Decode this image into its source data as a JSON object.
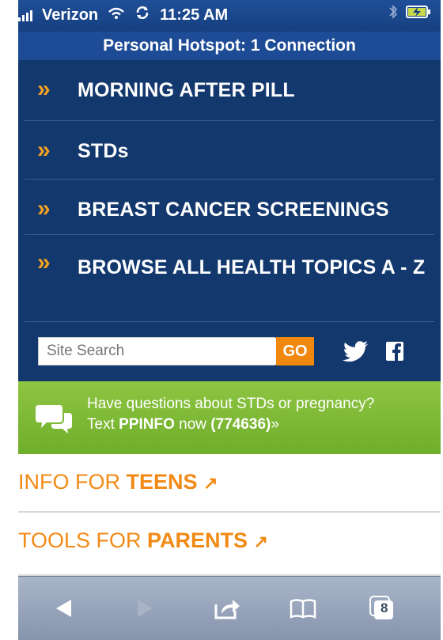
{
  "status": {
    "carrier": "Verizon",
    "time": "11:25 AM"
  },
  "hotspot": {
    "text": "Personal Hotspot: 1 Connection"
  },
  "nav": {
    "items": [
      {
        "label": "MORNING AFTER PILL"
      },
      {
        "label": "STDs"
      },
      {
        "label": "BREAST CANCER SCREENINGS"
      },
      {
        "label": "BROWSE ALL HEALTH TOPICS A - Z"
      }
    ],
    "chevron": "»"
  },
  "search": {
    "placeholder": "Site Search",
    "go_label": "GO"
  },
  "banner": {
    "line1": "Have questions about STDs or pregnancy?",
    "line2_prefix": "Text ",
    "line2_keyword": "PPINFO",
    "line2_mid": " now ",
    "line2_number": "(774636)",
    "line2_suffix": "»"
  },
  "links": [
    {
      "prefix": "INFO FOR ",
      "emph": "TEENS",
      "arrow": "↗"
    },
    {
      "prefix": "TOOLS FOR ",
      "emph": "PARENTS",
      "arrow": "↗"
    }
  ],
  "toolbar": {
    "tabs_count": "8"
  },
  "colors": {
    "nav_bg": "#12386e",
    "accent_orange": "#f28a16",
    "banner_green": "#7bbf36"
  },
  "icons": {
    "back": "back-arrow-icon",
    "forward": "forward-arrow-icon",
    "share": "share-icon",
    "bookmarks": "bookmarks-icon",
    "tabs": "tabs-icon",
    "twitter": "twitter-icon",
    "facebook": "facebook-icon",
    "chat": "chat-bubbles-icon"
  }
}
